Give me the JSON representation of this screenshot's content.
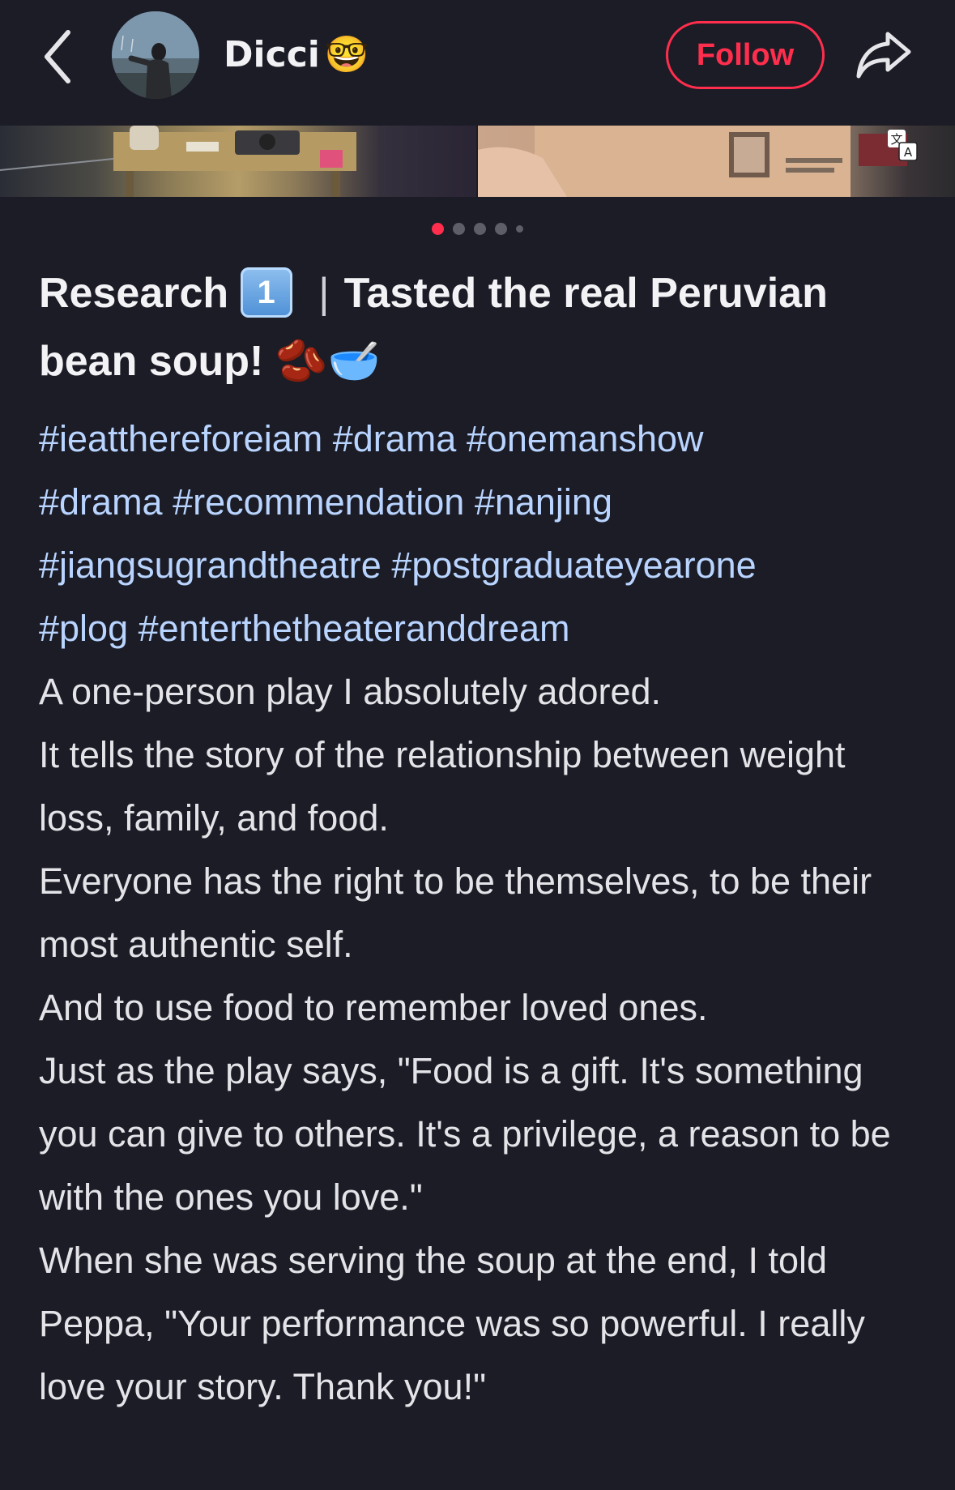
{
  "header": {
    "username": "Dicci",
    "username_emoji": "🤓",
    "follow_label": "Follow"
  },
  "carousel": {
    "total": 5,
    "active_index": 0
  },
  "post": {
    "title_part1": "Research",
    "title_keycap": "1",
    "title_separator": "|",
    "title_part2": "Tasted the real Peruvian bean soup!",
    "title_emojis": "🫘🥣",
    "tags": [
      "#ieatthereforeiam",
      "#drama",
      "#onemanshow",
      "#drama",
      "#recommendation",
      "#nanjing",
      "#jiangsugrandtheatre",
      "#postgraduateyearone",
      "#plog",
      "#enterthetheateranddream"
    ],
    "paragraphs": [
      "A one-person play I absolutely adored.",
      "It tells the story of the relationship between weight loss, family, and food.",
      "Everyone has the right to be themselves, to be their most authentic self.",
      "And to use food to remember loved ones.",
      "Just as the play says, \"Food is a gift. It's something you can give to others. It's a privilege, a reason to be with the ones you love.\"",
      "When she was serving the soup at the end, I told Peppa, \"Your performance was so powerful. I really love your story. Thank you!\""
    ]
  },
  "colors": {
    "background": "#1b1c26",
    "accent": "#ff2e4d",
    "hashtag": "#b8d4ff",
    "text": "#e3e3e8"
  },
  "icons": {
    "back": "chevron-left-icon",
    "share": "share-arrow-icon",
    "translate": "translate-icon"
  }
}
